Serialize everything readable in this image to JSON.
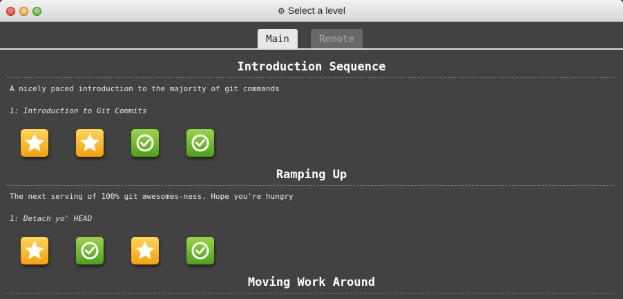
{
  "window": {
    "title": "Select a level",
    "title_icon": "gear-icon"
  },
  "tabs": [
    {
      "label": "Main",
      "active": true
    },
    {
      "label": "Remote",
      "active": false
    }
  ],
  "sections": [
    {
      "title": "Introduction Sequence",
      "description": "A nicely paced introduction to the majority of git commands",
      "subtitle": "1: Introduction to Git Commits",
      "levels": [
        "star",
        "star",
        "check",
        "check"
      ]
    },
    {
      "title": "Ramping Up",
      "description": "The next serving of 100% git awesomes-ness. Hope you're hungry",
      "subtitle": "1: Detach yo' HEAD",
      "levels": [
        "star",
        "check",
        "star",
        "check"
      ]
    },
    {
      "title": "Moving Work Around"
    }
  ],
  "colors": {
    "background": "#424242",
    "star_icon": "#f8b21c",
    "check_icon": "#6cb82e",
    "active_tab": "#e8e8e8",
    "inactive_tab": "#686868"
  }
}
